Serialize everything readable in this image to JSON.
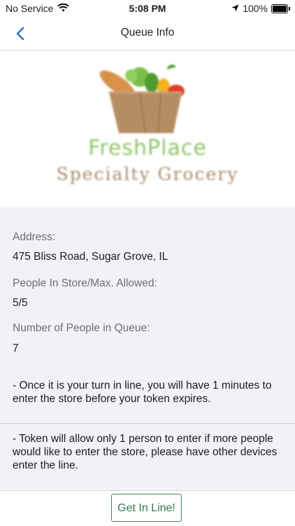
{
  "status_bar": {
    "carrier": "No Service",
    "time": "5:08 PM",
    "battery": "100%"
  },
  "nav": {
    "title": "Queue Info",
    "back_icon": "chevron-left-icon"
  },
  "logo": {
    "title": "FreshPlace",
    "subtitle": "Specialty Grocery"
  },
  "info": {
    "address_label": "Address:",
    "address_value": "475 Bliss Road, Sugar Grove, IL",
    "capacity_label": "People In Store/Max. Allowed:",
    "capacity_value": "5/5",
    "queue_label": "Number of People in Queue:",
    "queue_value": "7"
  },
  "notices": {
    "turn_notice": "- Once it is your turn in line, you will have 1 minutes to enter the store before your token expires.",
    "token_notice": "- Token will allow only 1 person to enter if more people would like to enter the store, please have other devices enter the line."
  },
  "footer": {
    "button_label": "Get In Line!"
  },
  "colors": {
    "accent": "#2e7d46",
    "nav_icon": "#1f6fd6"
  }
}
